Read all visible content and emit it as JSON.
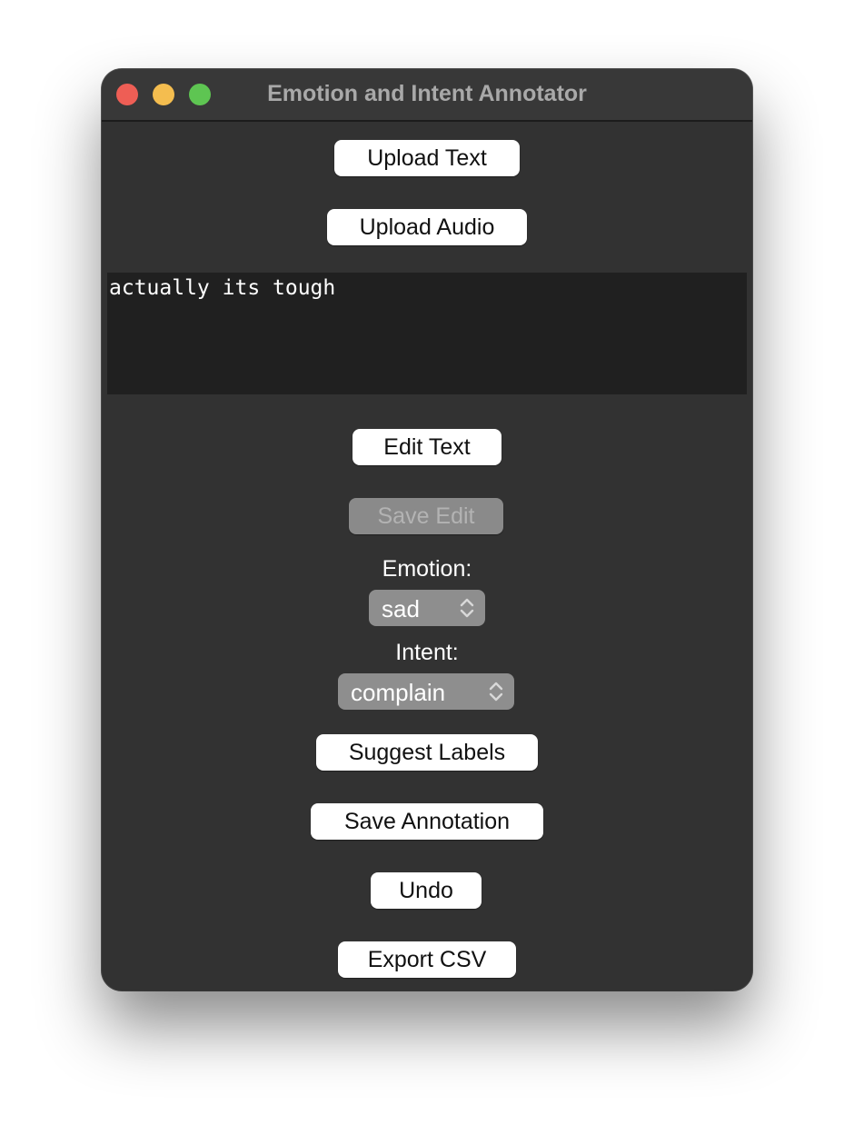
{
  "window": {
    "title": "Emotion and Intent Annotator"
  },
  "buttons": {
    "upload_text": "Upload Text",
    "upload_audio": "Upload Audio",
    "edit_text": "Edit Text",
    "save_edit": "Save Edit",
    "suggest_labels": "Suggest Labels",
    "save_annotation": "Save Annotation",
    "undo": "Undo",
    "export_csv": "Export CSV"
  },
  "text_area": {
    "content": "actually its tough"
  },
  "emotion": {
    "label": "Emotion:",
    "selected": "sad"
  },
  "intent": {
    "label": "Intent:",
    "selected": "complain"
  },
  "colors": {
    "window_bg": "#323232",
    "close": "#ee5e55",
    "minimize": "#f4bd4f",
    "maximize": "#5ec552"
  }
}
